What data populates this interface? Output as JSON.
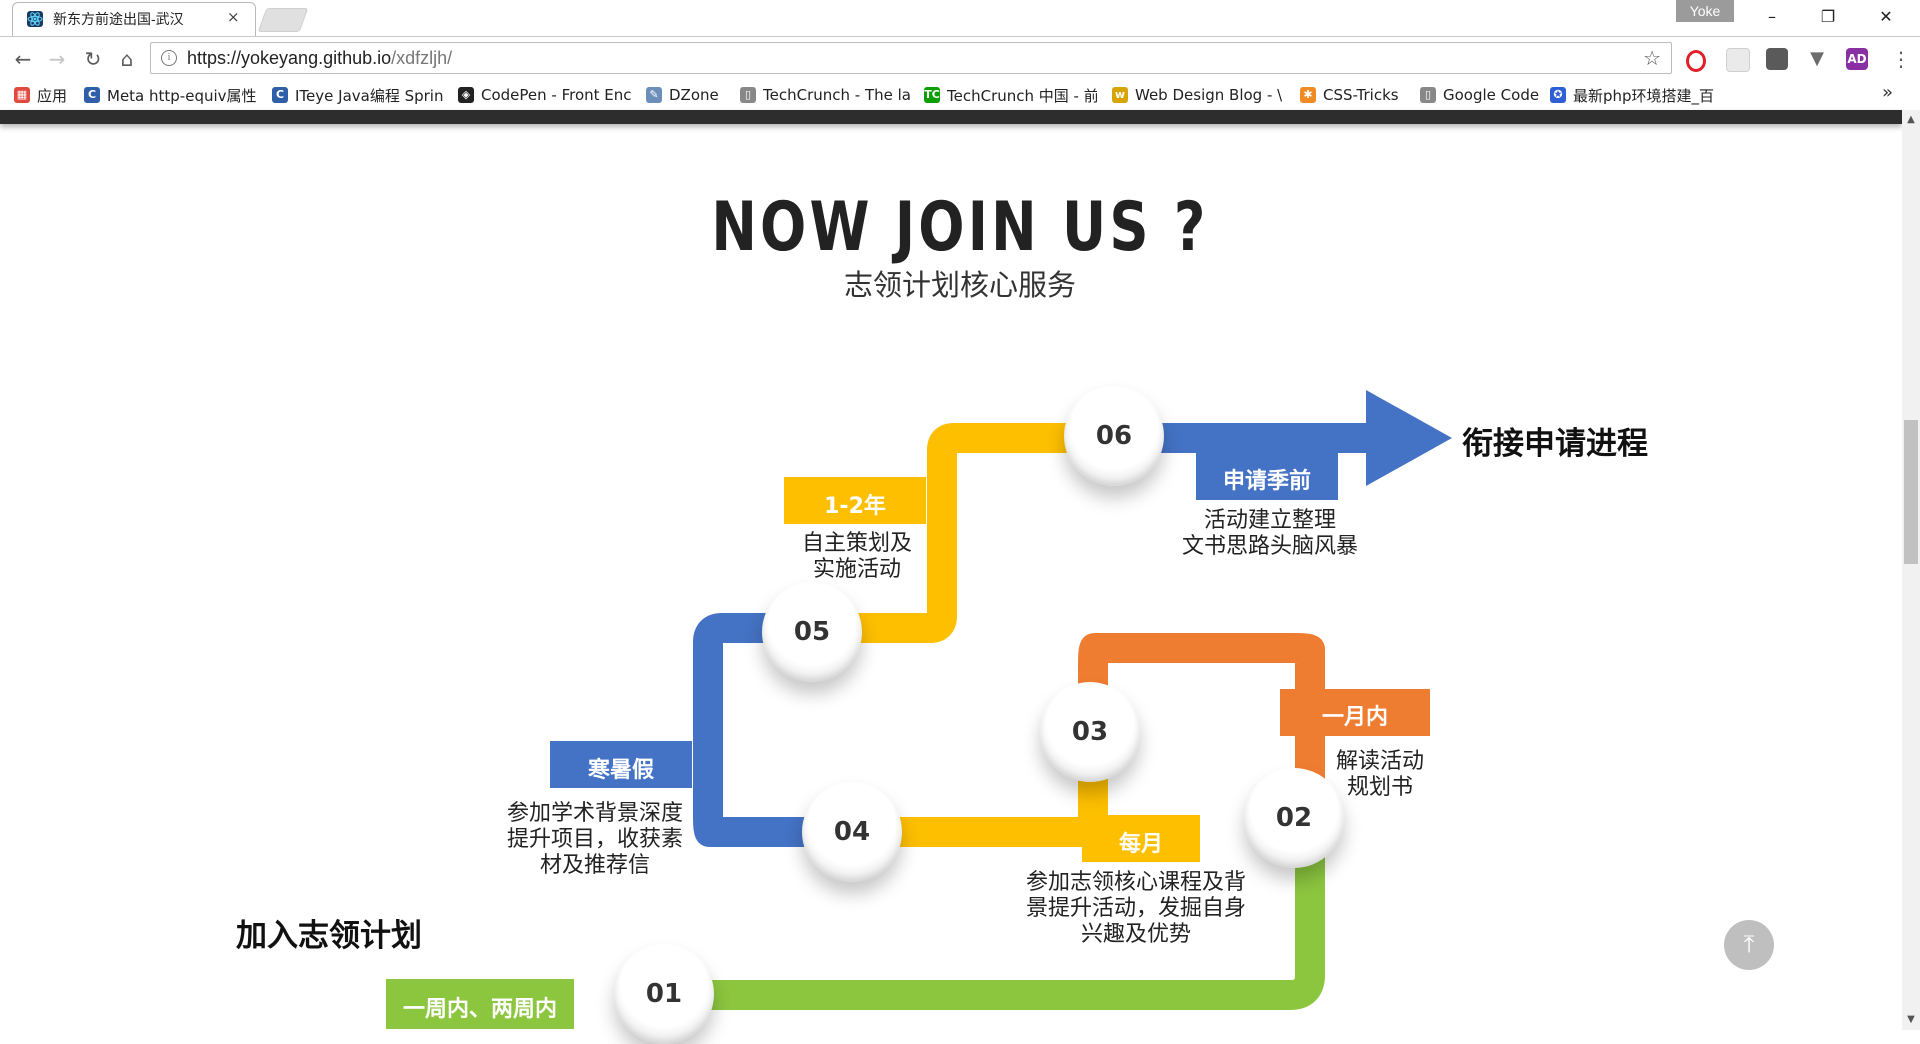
{
  "browser": {
    "tab_title": "新东方前途出国-武汉",
    "tab_close": "×",
    "profile": "Yoke",
    "url_host": "https://yokeyang.github.io",
    "url_path": "/xdfzljh/",
    "window": {
      "minimize": "–",
      "restore": "❐",
      "close": "✕"
    },
    "nav": {
      "back": "←",
      "forward": "→",
      "reload": "↻",
      "home": "⌂"
    },
    "extensions": [
      "opera-icon",
      "grid-icon",
      "screenshot-icon",
      "vue-icon",
      "adblock-icon"
    ],
    "menu": "⋮"
  },
  "bookmarks": [
    {
      "label": "应用",
      "icon": "apps-icon",
      "color": "#e04a3f"
    },
    {
      "label": "Meta http-equiv属性",
      "icon": "iteye-icon",
      "color": "#2f5fa8"
    },
    {
      "label": "ITeye Java编程 Sprin",
      "icon": "iteye-icon",
      "color": "#2f5fa8"
    },
    {
      "label": "CodePen - Front Enc",
      "icon": "codepen-icon",
      "color": "#222222"
    },
    {
      "label": "DZone",
      "icon": "dzone-icon",
      "color": "#6b8fb8"
    },
    {
      "label": "TechCrunch - The la",
      "icon": "page-icon",
      "color": "#888888"
    },
    {
      "label": "TechCrunch 中国 - 前",
      "icon": "techcrunch-icon",
      "color": "#0a9e01"
    },
    {
      "label": "Web Design Blog - \\",
      "icon": "webdesign-icon",
      "color": "#d8a400"
    },
    {
      "label": "CSS-Tricks",
      "icon": "csstricks-icon",
      "color": "#f08a24"
    },
    {
      "label": "Google Code",
      "icon": "page-icon",
      "color": "#888888"
    },
    {
      "label": "最新php环境搭建_百",
      "icon": "baidu-icon",
      "color": "#2e5fd4"
    }
  ],
  "bookmarks_more": "»",
  "page": {
    "title": "NOW JOIN US ?",
    "subtitle": "志领计划核心服务",
    "start_label": "加入志领计划",
    "end_label": "衔接申请进程",
    "back_to_top": "⤒",
    "steps": [
      {
        "num": "01",
        "tag": "一周内、两周内",
        "desc": "",
        "color": "#8cc63f"
      },
      {
        "num": "02",
        "tag": "一月内",
        "desc": "解读活动\n规划书",
        "color": "#ef7d31"
      },
      {
        "num": "03",
        "tag": "每月",
        "desc": "参加志领核心课程及背\n景提升活动，发掘自身\n兴趣及优势",
        "color": "#fdbf00"
      },
      {
        "num": "04",
        "tag": "寒暑假",
        "desc": "参加学术背景深度\n提升项目，收获素\n材及推荐信",
        "color": "#4472c4"
      },
      {
        "num": "05",
        "tag": "1-2年",
        "desc": "自主策划及\n实施活动",
        "color": "#fdbf00"
      },
      {
        "num": "06",
        "tag": "申请季前",
        "desc": "活动建立整理\n文书思路头脑风暴",
        "color": "#4472c4"
      }
    ]
  }
}
